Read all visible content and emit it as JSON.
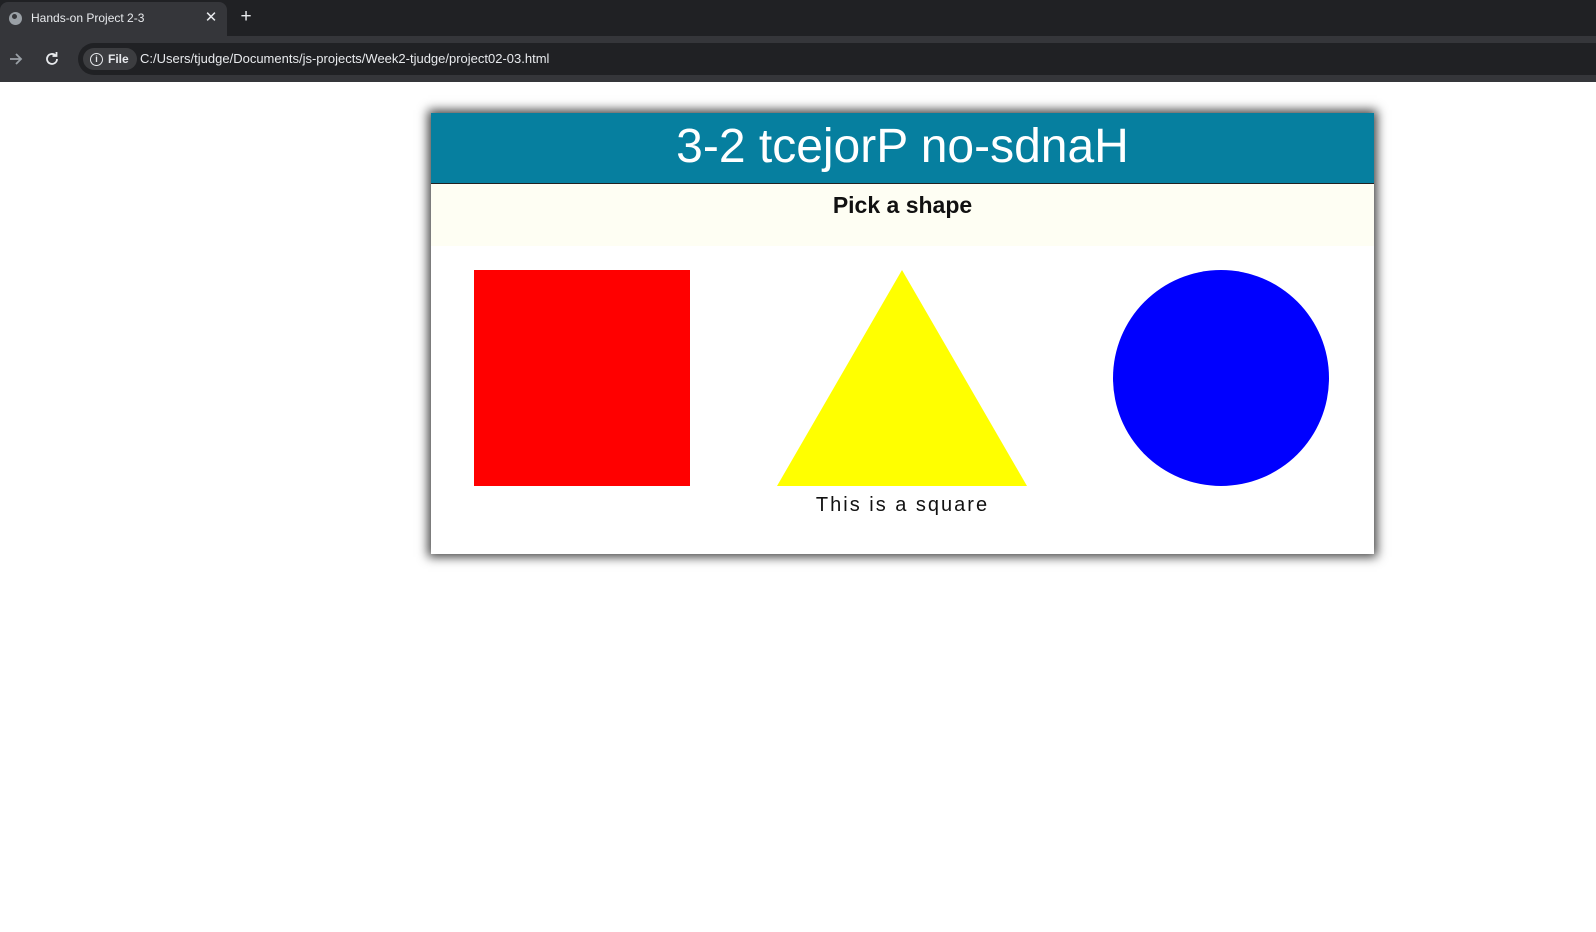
{
  "browser": {
    "tab_title": "Hands-on Project 2-3",
    "tab_icon": "globe-icon",
    "close_glyph": "✕",
    "new_tab_glyph": "+",
    "security_chip": "File",
    "url": "C:/Users/tjudge/Documents/js-projects/Week2-tjudge/project02-03.html"
  },
  "page": {
    "heading": "3-2 tcejorP no-sdnaH",
    "prompt": "Pick a shape",
    "caption": "This is a square",
    "header_color": "#067f9f"
  },
  "shapes": [
    {
      "name": "square",
      "color": "#ff0000"
    },
    {
      "name": "triangle",
      "color": "#ffff00"
    },
    {
      "name": "circle",
      "color": "#0000ff"
    }
  ]
}
